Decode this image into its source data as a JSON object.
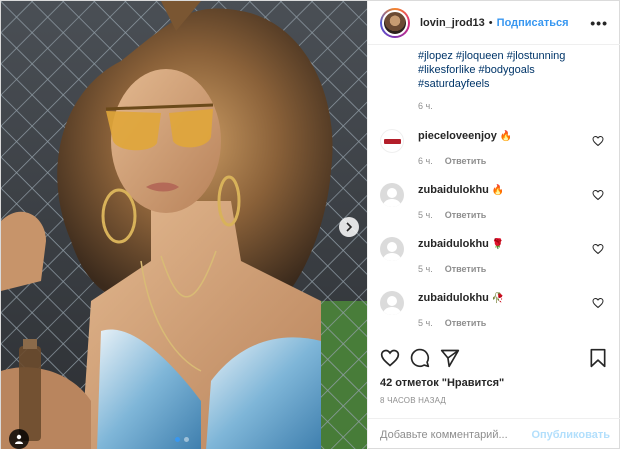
{
  "header": {
    "username": "lovin_jrod13",
    "separator": "•",
    "follow_label": "Подписаться",
    "more_icon": "more-icon"
  },
  "caption": {
    "tags": [
      "#jlopez",
      "#jloqueen",
      "#jlostunning",
      "#likesforlike",
      "#bodygoals",
      "#saturdayfeels"
    ],
    "time": "6 ч."
  },
  "comments": [
    {
      "user": "pieceloveenjoy",
      "emoji": "🔥",
      "time": "6 ч.",
      "reply": "Ответить",
      "avatar": "logo"
    },
    {
      "user": "zubaidulokhu",
      "emoji": "🔥",
      "time": "5 ч.",
      "reply": "Ответить",
      "avatar": "default"
    },
    {
      "user": "zubaidulokhu",
      "emoji": "🌹",
      "time": "5 ч.",
      "reply": "Ответить",
      "avatar": "default"
    },
    {
      "user": "zubaidulokhu",
      "emoji": "🥀",
      "time": "5 ч.",
      "reply": "Ответить",
      "avatar": "default"
    }
  ],
  "actions": {
    "icons": [
      "heart-icon",
      "comment-icon",
      "share-icon",
      "bookmark-icon"
    ]
  },
  "likes_text": "42 отметок \"Нравится\"",
  "time_ago": "8 ЧАСОВ НАЗАД",
  "add_comment": {
    "placeholder": "Добавьте комментарий...",
    "publish_label": "Опубликовать"
  },
  "carousel": {
    "current": 1,
    "total": 2
  },
  "colors": {
    "link": "#003569",
    "follow": "#3897f0",
    "publish_disabled": "#b2dffc",
    "muted": "#8e8e8e"
  }
}
